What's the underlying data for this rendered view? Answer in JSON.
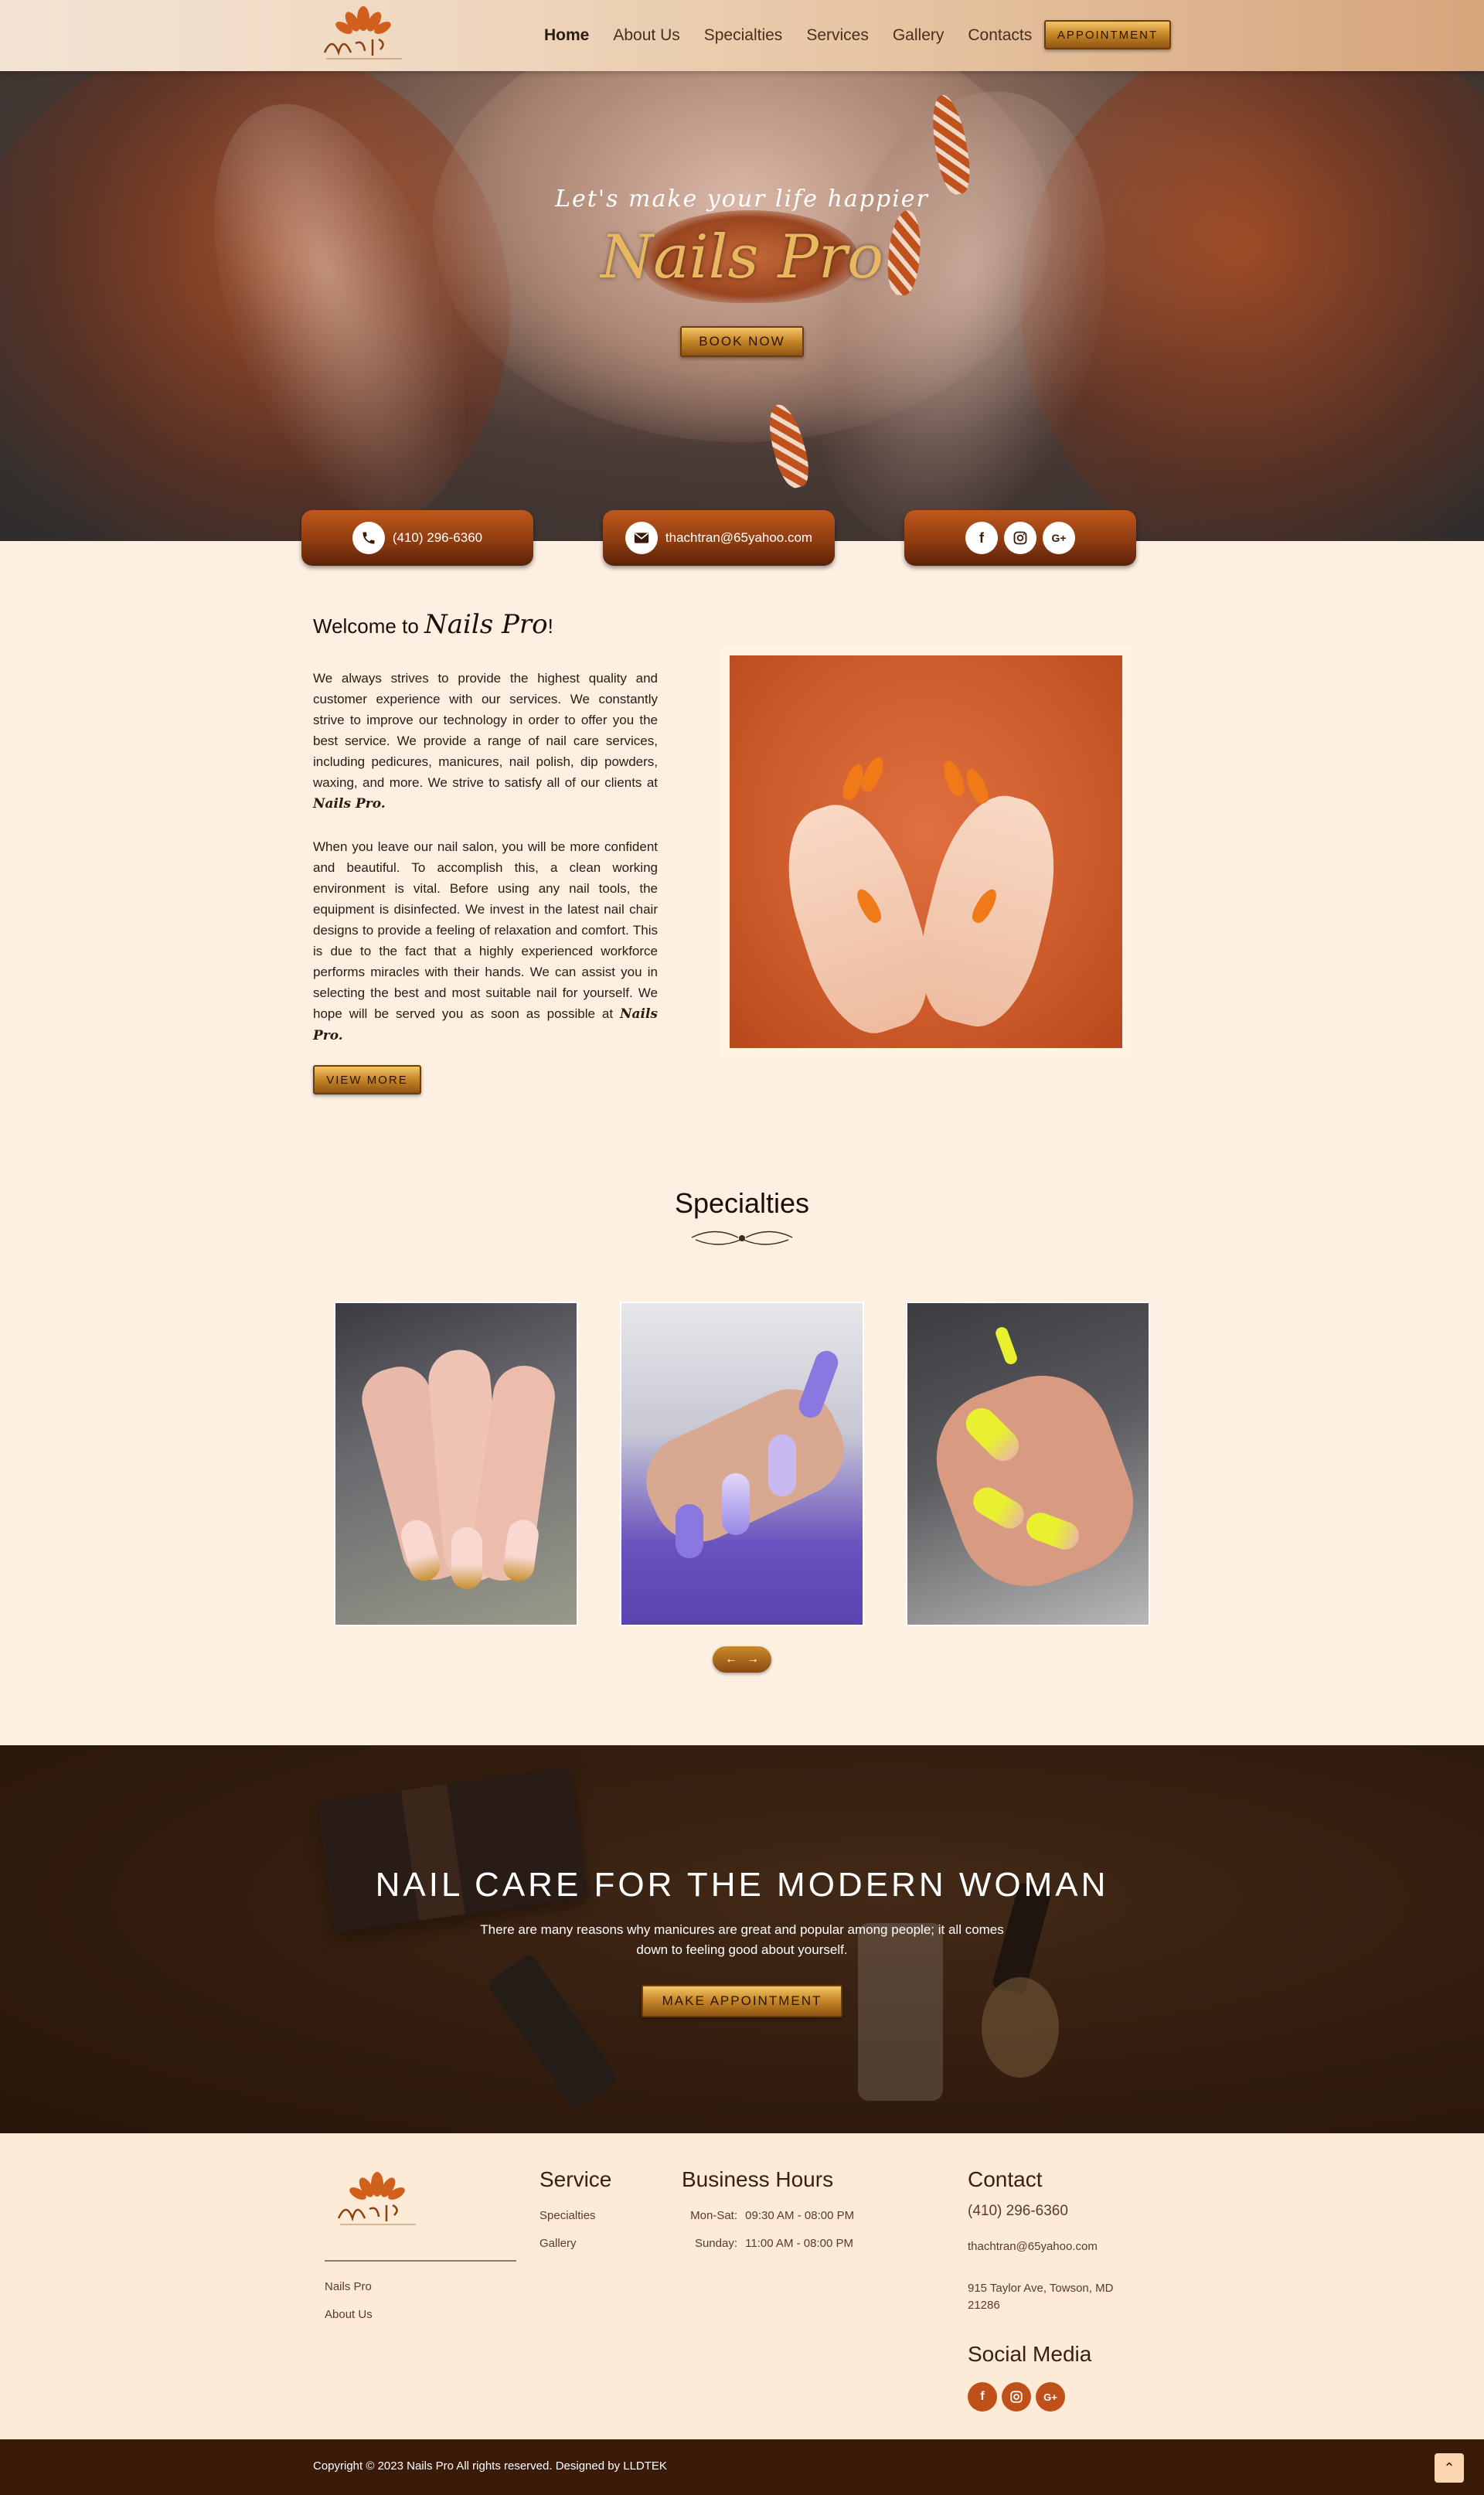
{
  "header": {
    "nav": [
      "Home",
      "About Us",
      "Specialties",
      "Services",
      "Gallery",
      "Contacts"
    ],
    "appointment_label": "APPOINTMENT"
  },
  "hero": {
    "tagline": "Let's make your life happier",
    "title": "Nails Pro",
    "book_label": "BOOK NOW"
  },
  "contact_bar": {
    "phone": "(410) 296-6360",
    "email": "thachtran@65yahoo.com"
  },
  "welcome": {
    "title_prefix": "Welcome to",
    "title_brand": "Nails Pro",
    "title_suffix": "!",
    "para1": "We always strives to provide the highest quality and customer experience with our services. We constantly strive to improve our technology in order to offer you the best service. We provide a range of nail care services, including pedicures, manicures, nail polish, dip powders, waxing, and more. We strive to satisfy all of our clients at",
    "para1_brand": "Nails Pro.",
    "para2": "When you leave our nail salon, you will be more confident and beautiful. To accomplish this, a clean working environment is vital. Before using any nail tools, the equipment is disinfected. We invest in the latest nail chair designs to provide a feeling of relaxation and comfort. This is due to the fact that a highly experienced workforce performs miracles with their hands. We can assist you in selecting the best and most suitable nail for yourself. We hope will be served you as soon as possible at",
    "para2_brand": "Nails Pro.",
    "view_more_label": "VIEW MORE"
  },
  "specialties": {
    "title": "Specialties"
  },
  "cta": {
    "title": "NAIL CARE FOR THE MODERN WOMAN",
    "text": "There are many reasons why manicures are great and popular among people; it all comes down to feeling good about yourself.",
    "button_label": "MAKE APPOINTMENT"
  },
  "footer": {
    "links": [
      "Nails Pro",
      "About Us"
    ],
    "service_heading": "Service",
    "service_links": [
      "Specialties",
      "Gallery"
    ],
    "hours_heading": "Business Hours",
    "hours": [
      {
        "day": "Mon-Sat:",
        "time": "09:30 AM - 08:00 PM"
      },
      {
        "day": "Sunday:",
        "time": "11:00 AM - 08:00 PM"
      }
    ],
    "contact_heading": "Contact",
    "phone": "(410) 296-6360",
    "email": "thachtran@65yahoo.com",
    "address": "915 Taylor Ave, Towson, MD 21286",
    "social_heading": "Social Media",
    "copyright": "Copyright © 2023 Nails Pro All rights reserved. Designed by LLDTEK"
  },
  "colors": {
    "accent": "#c0501a",
    "gold": "#c98a2a",
    "background": "#fdf0e3",
    "bottom_bar": "#3a1a08"
  },
  "icons": [
    "phone-icon",
    "mail-icon",
    "facebook-icon",
    "instagram-icon",
    "google-plus-icon",
    "arrow-left-icon",
    "arrow-right-icon",
    "chevron-up-icon"
  ]
}
